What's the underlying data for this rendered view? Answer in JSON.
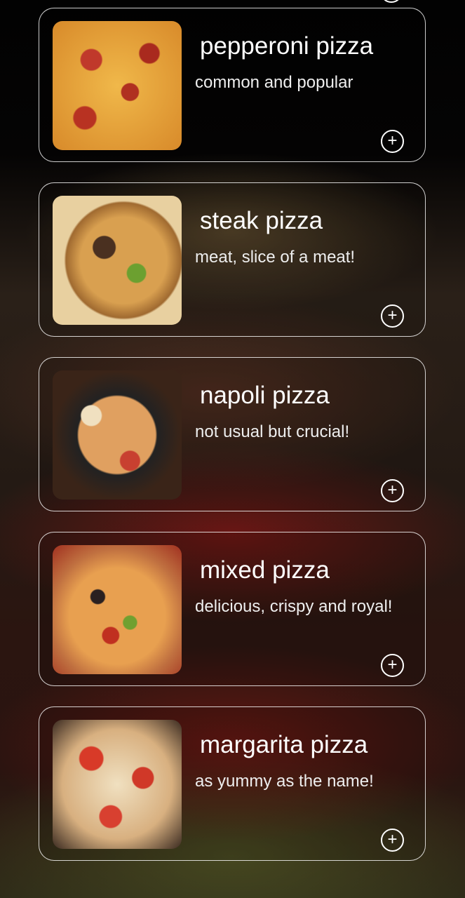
{
  "items": [
    {
      "title": "pepperoni pizza",
      "description": "common and popular",
      "add_icon": "plus-circle-icon"
    },
    {
      "title": "steak pizza",
      "description": "meat, slice of a meat!",
      "add_icon": "plus-circle-icon"
    },
    {
      "title": "napoli pizza",
      "description": "not usual but crucial!",
      "add_icon": "plus-circle-icon"
    },
    {
      "title": "mixed pizza",
      "description": "delicious, crispy and royal!",
      "add_icon": "plus-circle-icon"
    },
    {
      "title": "margarita pizza",
      "description": "as yummy as the name!",
      "add_icon": "plus-circle-icon"
    }
  ],
  "add_symbol": "+"
}
